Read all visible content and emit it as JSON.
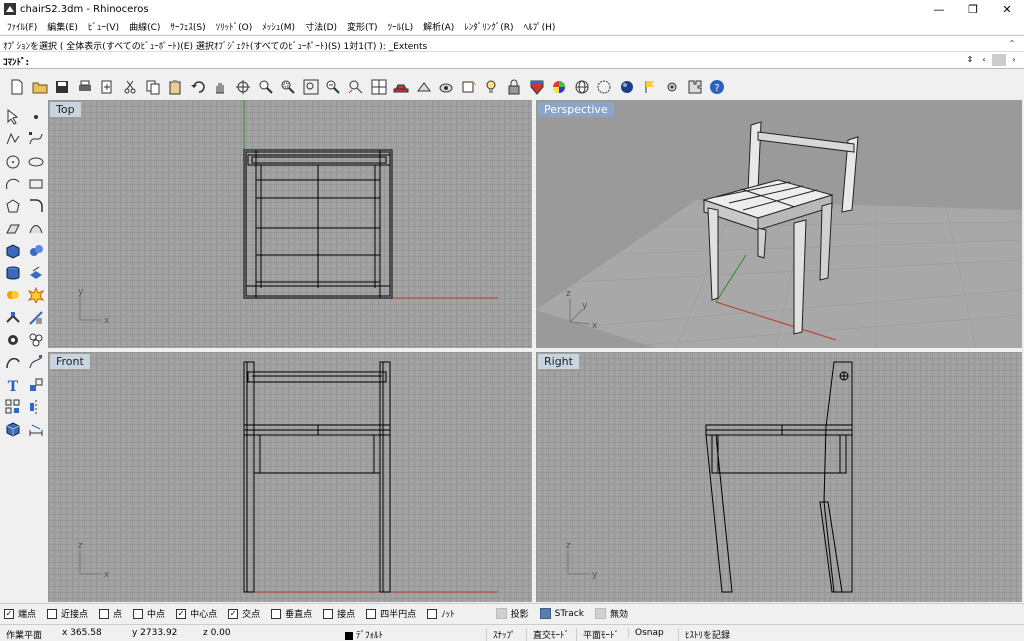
{
  "window": {
    "title": "chairS2.3dm - Rhinoceros",
    "controls": [
      "—",
      "❐",
      "✕"
    ]
  },
  "menu": [
    "ﾌｧｲﾙ(F)",
    "編集(E)",
    "ﾋﾞｭｰ(V)",
    "曲線(C)",
    "ｻｰﾌｪｽ(S)",
    "ｿﾘｯﾄﾞ(O)",
    "ﾒｯｼｭ(M)",
    "寸法(D)",
    "変形(T)",
    "ﾂｰﾙ(L)",
    "解析(A)",
    "ﾚﾝﾀﾞﾘﾝｸﾞ(R)",
    "ﾍﾙﾌﾟ(H)"
  ],
  "command": {
    "history": "ｵﾌﾟｼｮﾝを選択 ( 全体表示(すべてのﾋﾞｭｰﾎﾟｰﾄ)(E)  選択ｵﾌﾞｼﾞｪｸﾄ(すべてのﾋﾞｭｰﾎﾟｰﾄ)(S)  1対1(T) ): _Extents",
    "prompt": "ｺﾏﾝﾄﾞ:"
  },
  "toolbar_icons": [
    "new-file-icon",
    "open-file-icon",
    "save-icon",
    "print-icon",
    "import-icon",
    "cut-icon",
    "copy-icon",
    "paste-icon",
    "undo-icon",
    "pan-hand-icon",
    "rotate-view-icon",
    "zoom-icon",
    "zoom-window-icon",
    "zoom-extents-icon",
    "zoom-selected-icon",
    "zoom-all-icon",
    "four-viewports-icon",
    "car-icon",
    "grid-icon",
    "camera-icon",
    "layer-icon",
    "lightbulb-icon",
    "lock-icon",
    "shield-icon",
    "color-wheel-icon",
    "sphere-wire-icon",
    "sphere-outline-icon",
    "sphere-render-icon",
    "flag-icon",
    "gear-icon",
    "puzzle-icon",
    "help-icon"
  ],
  "sidebar_icons": [
    [
      "select-arrow-icon",
      "point-icon"
    ],
    [
      "polyline-icon",
      "curve-icon"
    ],
    [
      "circle-icon",
      "ellipse-icon"
    ],
    [
      "arc-icon",
      "rectangle-icon"
    ],
    [
      "polygon-icon",
      "fillet-curve-icon"
    ],
    [
      "surface-icon",
      "surface-edge-icon"
    ],
    [
      "box-solid-icon",
      "sphere-solid-icon"
    ],
    [
      "cylinder-solid-icon",
      "extrude-icon"
    ],
    [
      "boolean-icon",
      "explode-icon"
    ],
    [
      "split-icon",
      "trim-icon"
    ],
    [
      "point-cloud-icon",
      "group-icon"
    ],
    [
      "bend-icon",
      "edit-point-icon"
    ],
    [
      "text-icon",
      "scale-icon"
    ],
    [
      "array-icon",
      "mirror-icon"
    ],
    [
      "box-shaded-icon",
      "dimension-icon"
    ]
  ],
  "viewports": {
    "top": {
      "label": "Top",
      "axis1": "x",
      "axis2": "y"
    },
    "perspective": {
      "label": "Perspective",
      "axis1": "x",
      "axis2": "y",
      "axis3": "z"
    },
    "front": {
      "label": "Front",
      "axis1": "x",
      "axis2": "z"
    },
    "right": {
      "label": "Right",
      "axis1": "y",
      "axis2": "z"
    }
  },
  "osnap": [
    {
      "label": "端点",
      "checked": true
    },
    {
      "label": "近接点",
      "checked": false
    },
    {
      "label": "点",
      "checked": false
    },
    {
      "label": "中点",
      "checked": false
    },
    {
      "label": "中心点",
      "checked": true
    },
    {
      "label": "交点",
      "checked": true
    },
    {
      "label": "垂直点",
      "checked": false
    },
    {
      "label": "接点",
      "checked": false
    },
    {
      "label": "四半円点",
      "checked": false
    },
    {
      "label": "ﾉｯﾄ",
      "checked": false
    }
  ],
  "osnap_extra": [
    {
      "label": "投影",
      "state": "grey"
    },
    {
      "label": "STrack",
      "state": "blue"
    },
    {
      "label": "無効",
      "state": "grey"
    }
  ],
  "status": {
    "cplane": "作業平面",
    "x": "x 365.58",
    "y": "y 2733.92",
    "z": "z 0.00",
    "layer": "ﾃﾞﾌｫﾙﾄ",
    "snap": "ｽﾅｯﾌﾟ",
    "ortho": "直交ﾓｰﾄﾞ",
    "planar": "平面ﾓｰﾄﾞ",
    "osnap": "Osnap",
    "history": "ﾋｽﾄﾘを記録"
  },
  "colors": {
    "viewport_bg": "#a3a3a3",
    "x_axis": "#c0392b",
    "y_axis": "#2e8b2e",
    "active_label": "#8aa5c8"
  }
}
